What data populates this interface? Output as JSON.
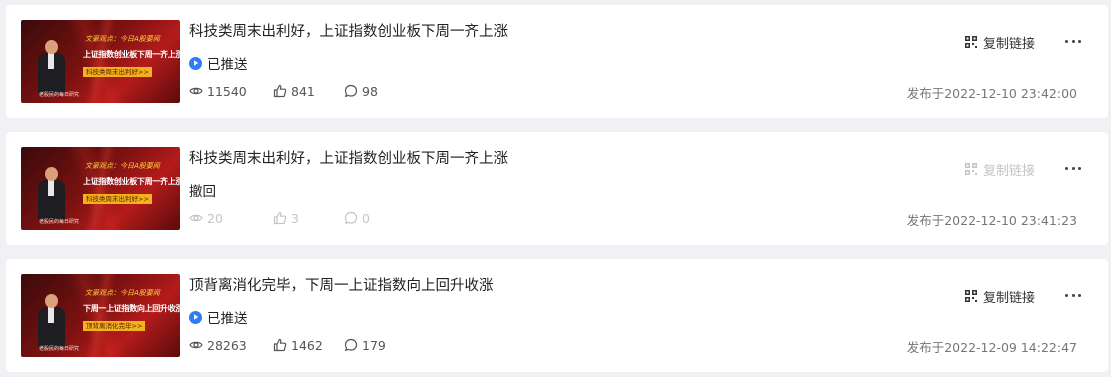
{
  "articles": [
    {
      "title": "科技类周末出利好，上证指数创业板下周一齐上涨",
      "status": "已推送",
      "views": "11540",
      "likes": "841",
      "comments": "98",
      "copy_label": "复制链接",
      "date": "发布于2022-12-10 23:42:00",
      "thumb": {
        "line1": "文豪观点：今日A股要闻",
        "line2": "上证指数创业板下周一齐上涨",
        "line3": "科技类周末出利好>>",
        "footer": "老股民的每日研究"
      }
    },
    {
      "title": "科技类周末出利好，上证指数创业板下周一齐上涨",
      "status": "撤回",
      "views": "20",
      "likes": "3",
      "comments": "0",
      "copy_label": "复制链接",
      "date": "发布于2022-12-10 23:41:23",
      "thumb": {
        "line1": "文豪观点：今日A股要闻",
        "line2": "上证指数创业板下周一齐上涨",
        "line3": "科技类周末出利好>>",
        "footer": "老股民的每日研究"
      }
    },
    {
      "title": "顶背离消化完毕，下周一上证指数向上回升收涨",
      "status": "已推送",
      "views": "28263",
      "likes": "1462",
      "comments": "179",
      "copy_label": "复制链接",
      "date": "发布于2022-12-09 14:22:47",
      "thumb": {
        "line1": "文豪观点：今日A股要闻",
        "line2": "下周一上证指数向上回升收涨",
        "line3": "顶背离消化完毕>>",
        "footer": "老股民的每日研究"
      }
    }
  ],
  "colors": {
    "status_badge": "#2f7cf6",
    "disabled_text": "#c4c4c4",
    "thumb_red": "#b51b1b"
  },
  "icons": {
    "status": "push-check-icon",
    "views": "eye-icon",
    "likes": "thumbs-up-icon",
    "comments": "comment-bubble-icon",
    "copy": "qr-code-icon",
    "more": "ellipsis-icon"
  }
}
